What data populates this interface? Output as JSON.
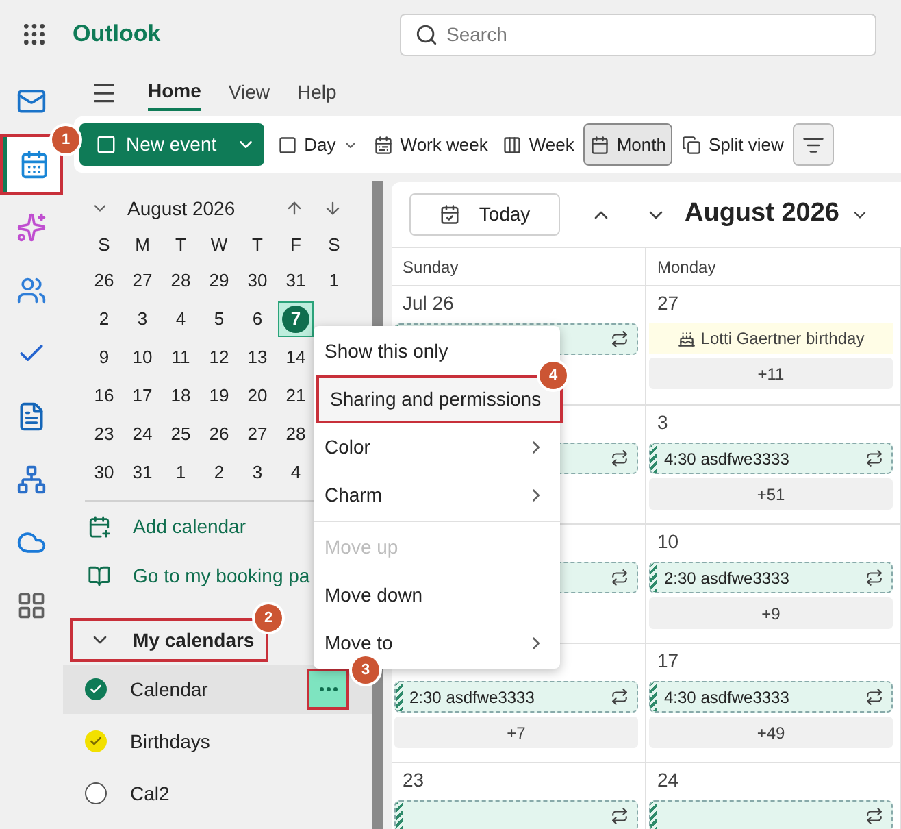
{
  "app": {
    "name": "Outlook"
  },
  "search": {
    "placeholder": "Search"
  },
  "rail": [
    {
      "kind": "mail",
      "selected": false
    },
    {
      "kind": "calendar",
      "selected": true,
      "annotation": "1"
    },
    {
      "kind": "copilot",
      "selected": false
    },
    {
      "kind": "people",
      "selected": false
    },
    {
      "kind": "todo",
      "selected": false
    },
    {
      "kind": "files",
      "selected": false
    },
    {
      "kind": "org",
      "selected": false
    },
    {
      "kind": "cloud",
      "selected": false
    },
    {
      "kind": "apps",
      "selected": false
    }
  ],
  "tabs": [
    {
      "label": "Home",
      "selected": true
    },
    {
      "label": "View",
      "selected": false
    },
    {
      "label": "Help",
      "selected": false
    }
  ],
  "new_event": {
    "label": "New event"
  },
  "views": [
    {
      "kind": "day",
      "label": "Day",
      "selected": false,
      "dropdown": true
    },
    {
      "kind": "workweek",
      "label": "Work week",
      "selected": false,
      "dropdown": false
    },
    {
      "kind": "week",
      "label": "Week",
      "selected": false,
      "dropdown": false
    },
    {
      "kind": "month",
      "label": "Month",
      "selected": true,
      "dropdown": false
    },
    {
      "kind": "split",
      "label": "Split view",
      "selected": false,
      "dropdown": false
    }
  ],
  "mini_calendar": {
    "title": "August 2026",
    "weekdays": [
      "S",
      "M",
      "T",
      "W",
      "T",
      "F",
      "S"
    ],
    "weeks": [
      [
        {
          "day": "26",
          "selected": false
        },
        {
          "day": "27",
          "selected": false
        },
        {
          "day": "28",
          "selected": false
        },
        {
          "day": "29",
          "selected": false
        },
        {
          "day": "30",
          "selected": false
        },
        {
          "day": "31",
          "selected": false
        },
        {
          "day": "1",
          "selected": false
        }
      ],
      [
        {
          "day": "2",
          "selected": false
        },
        {
          "day": "3",
          "selected": false
        },
        {
          "day": "4",
          "selected": false
        },
        {
          "day": "5",
          "selected": false
        },
        {
          "day": "6",
          "selected": false
        },
        {
          "day": "7",
          "selected": true
        }
      ],
      [
        {
          "day": "9",
          "selected": false
        },
        {
          "day": "10",
          "selected": false
        },
        {
          "day": "11",
          "selected": false
        },
        {
          "day": "12",
          "selected": false
        },
        {
          "day": "13",
          "selected": false
        },
        {
          "day": "14",
          "selected": false
        }
      ],
      [
        {
          "day": "16",
          "selected": false
        },
        {
          "day": "17",
          "selected": false
        },
        {
          "day": "18",
          "selected": false
        },
        {
          "day": "19",
          "selected": false
        },
        {
          "day": "20",
          "selected": false
        },
        {
          "day": "21",
          "selected": false
        }
      ],
      [
        {
          "day": "23",
          "selected": false
        },
        {
          "day": "24",
          "selected": false
        },
        {
          "day": "25",
          "selected": false
        },
        {
          "day": "26",
          "selected": false
        },
        {
          "day": "27",
          "selected": false
        },
        {
          "day": "28",
          "selected": false
        }
      ],
      [
        {
          "day": "30",
          "selected": false
        },
        {
          "day": "31",
          "selected": false
        },
        {
          "day": "1",
          "selected": false
        },
        {
          "day": "2",
          "selected": false
        },
        {
          "day": "3",
          "selected": false
        },
        {
          "day": "4",
          "selected": false
        }
      ]
    ]
  },
  "links": [
    {
      "kind": "add",
      "label": "Add calendar"
    },
    {
      "kind": "booking",
      "label": "Go to my booking pa"
    }
  ],
  "my_calendars": {
    "title": "My calendars",
    "expanded": true,
    "annotation": "2",
    "items": [
      {
        "name": "Calendar",
        "checked": true,
        "selected": true,
        "color": "#0f7b57",
        "annotation": "3"
      },
      {
        "name": "Birthdays",
        "checked": true,
        "selected": false,
        "color": "#f2e000"
      },
      {
        "name": "Cal2",
        "checked": false,
        "selected": false
      }
    ]
  },
  "menu": [
    {
      "kind": "item",
      "label": "Show this only",
      "disabled": false
    },
    {
      "kind": "item",
      "label": "Sharing and permissions",
      "disabled": false,
      "annotation": "4"
    },
    {
      "kind": "submenu",
      "label": "Color",
      "disabled": false
    },
    {
      "kind": "submenu",
      "label": "Charm",
      "disabled": false
    },
    {
      "kind": "divider"
    },
    {
      "kind": "item",
      "label": "Move up",
      "disabled": true
    },
    {
      "kind": "item",
      "label": "Move down",
      "disabled": false
    },
    {
      "kind": "submenu",
      "label": "Move to",
      "disabled": false
    }
  ],
  "calendar": {
    "today": "Today",
    "title": "August 2026",
    "columns": [
      "Sunday",
      "Monday"
    ],
    "weeks": [
      [
        {
          "date": "Jul 26",
          "events": [
            {
              "kind": "recurring"
            }
          ]
        },
        {
          "date": "27",
          "events": [
            {
              "kind": "birthday",
              "text": "Lotti Gaertner birthday"
            }
          ],
          "more": "+11"
        }
      ],
      [
        {
          "events": [
            {
              "kind": "recurring"
            }
          ]
        },
        {
          "date": "3",
          "events": [
            {
              "kind": "recurring",
              "text": "4:30 asdfwe3333"
            }
          ],
          "more": "+51"
        }
      ],
      [
        {
          "events": [
            {
              "kind": "recurring"
            }
          ]
        },
        {
          "date": "10",
          "events": [
            {
              "kind": "recurring",
              "text": "2:30 asdfwe3333"
            }
          ],
          "more": "+9"
        }
      ],
      [
        {
          "events": [
            {
              "kind": "recurring",
              "text": "2:30 asdfwe3333"
            }
          ],
          "more": "+7"
        },
        {
          "date": "17",
          "events": [
            {
              "kind": "recurring",
              "text": "4:30 asdfwe3333"
            }
          ],
          "more": "+49"
        }
      ],
      [
        {
          "date": "23",
          "events": [
            {
              "kind": "recurring"
            }
          ]
        },
        {
          "date": "24",
          "events": [
            {
              "kind": "recurring"
            }
          ]
        }
      ]
    ]
  }
}
